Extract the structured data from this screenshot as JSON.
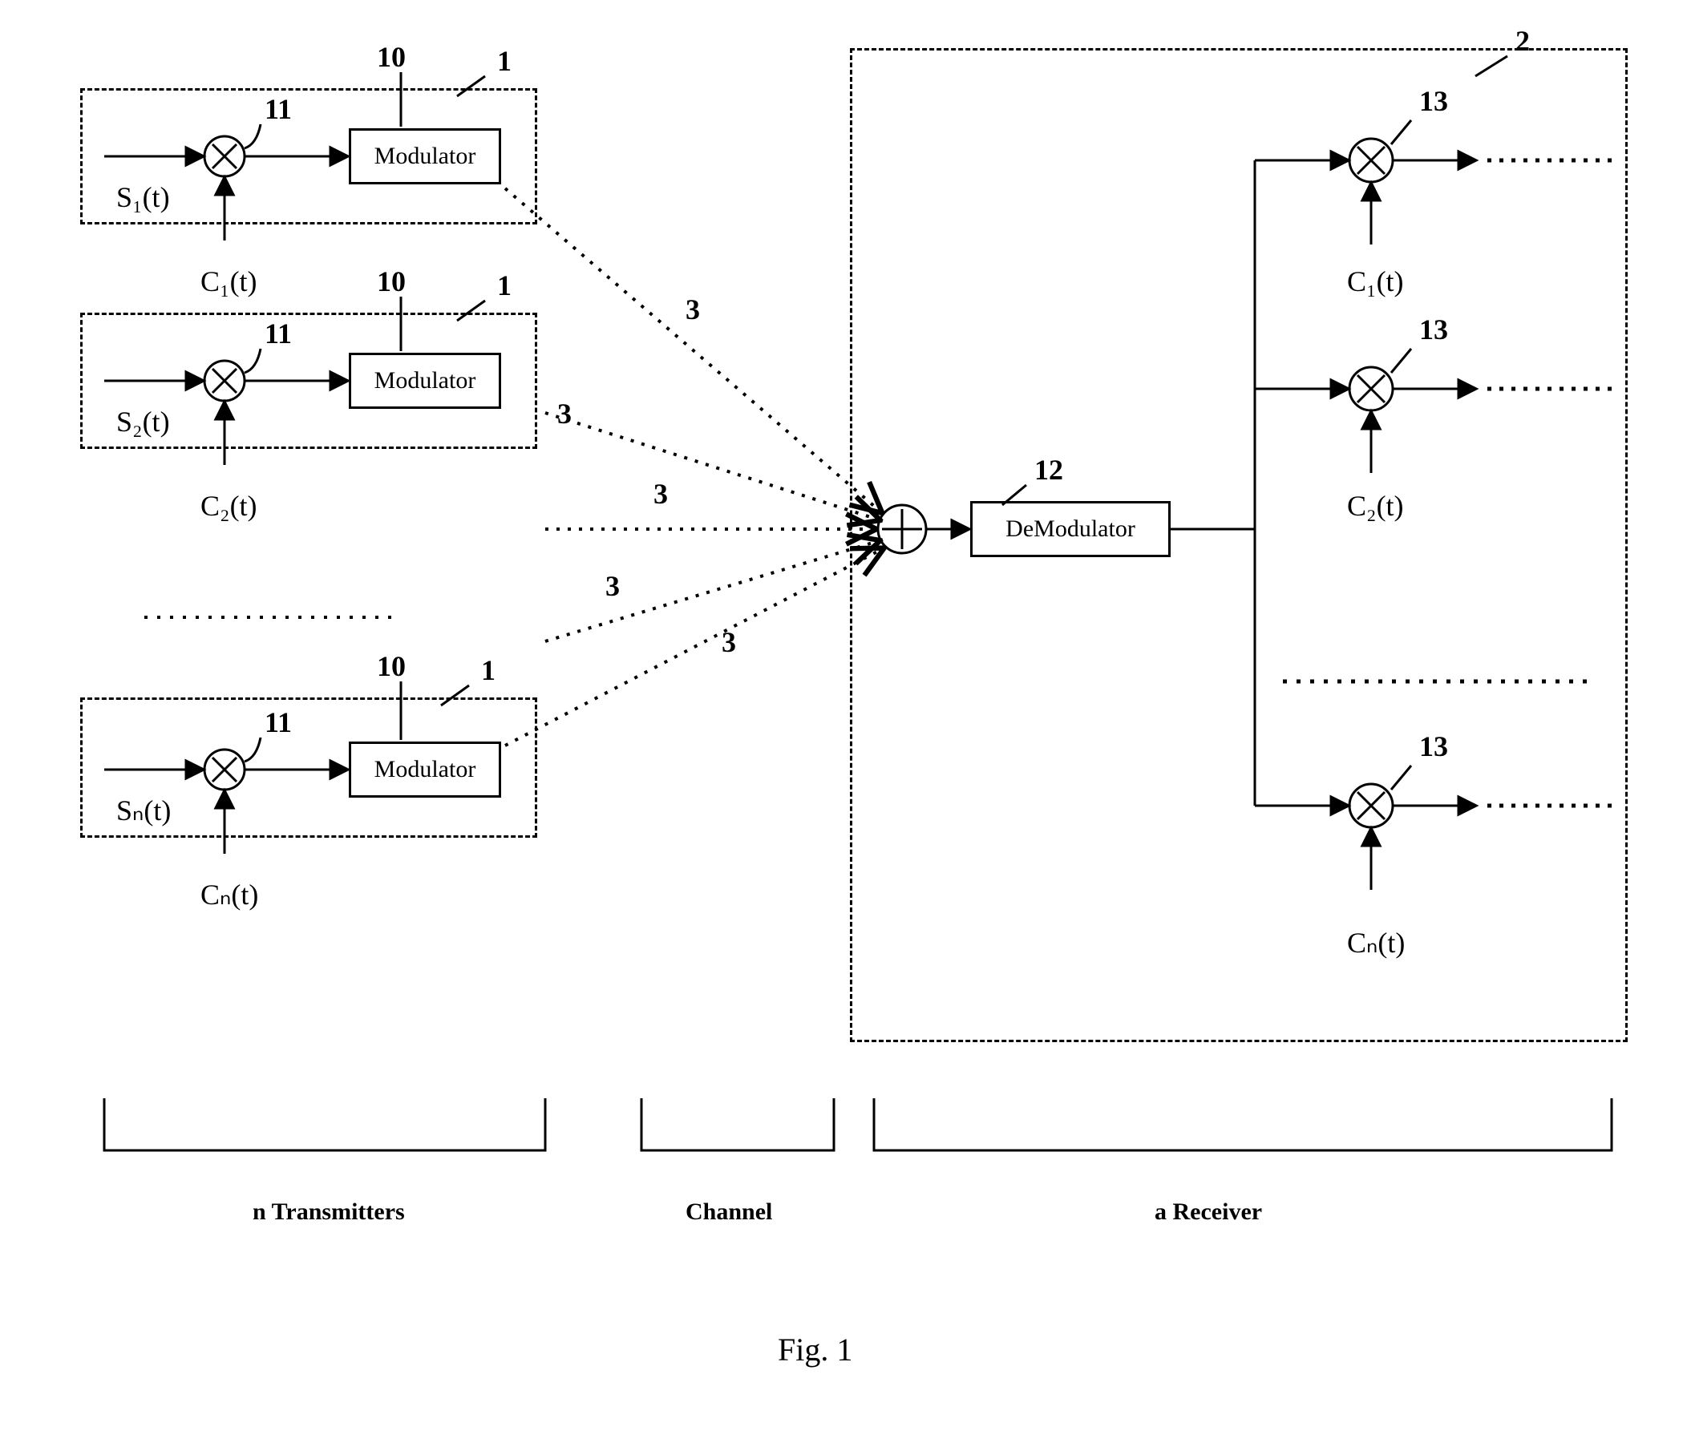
{
  "labels": {
    "ten": "10",
    "one": "1",
    "eleven": "11",
    "two": "2",
    "twelve": "12",
    "thirteen": "13",
    "three": "3"
  },
  "blocks": {
    "modulator": "Modulator",
    "demodulator": "DeModulator"
  },
  "signals": {
    "s1": "S₁(t)",
    "s2": "S₂(t)",
    "sn": "Sₙ(t)",
    "c1": "C₁(t)",
    "c2": "C₂(t)",
    "cn": "Cₙ(t)"
  },
  "sections": {
    "tx": "n Transmitters",
    "channel": "Channel",
    "rx": "a Receiver"
  },
  "figure": "Fig. 1"
}
